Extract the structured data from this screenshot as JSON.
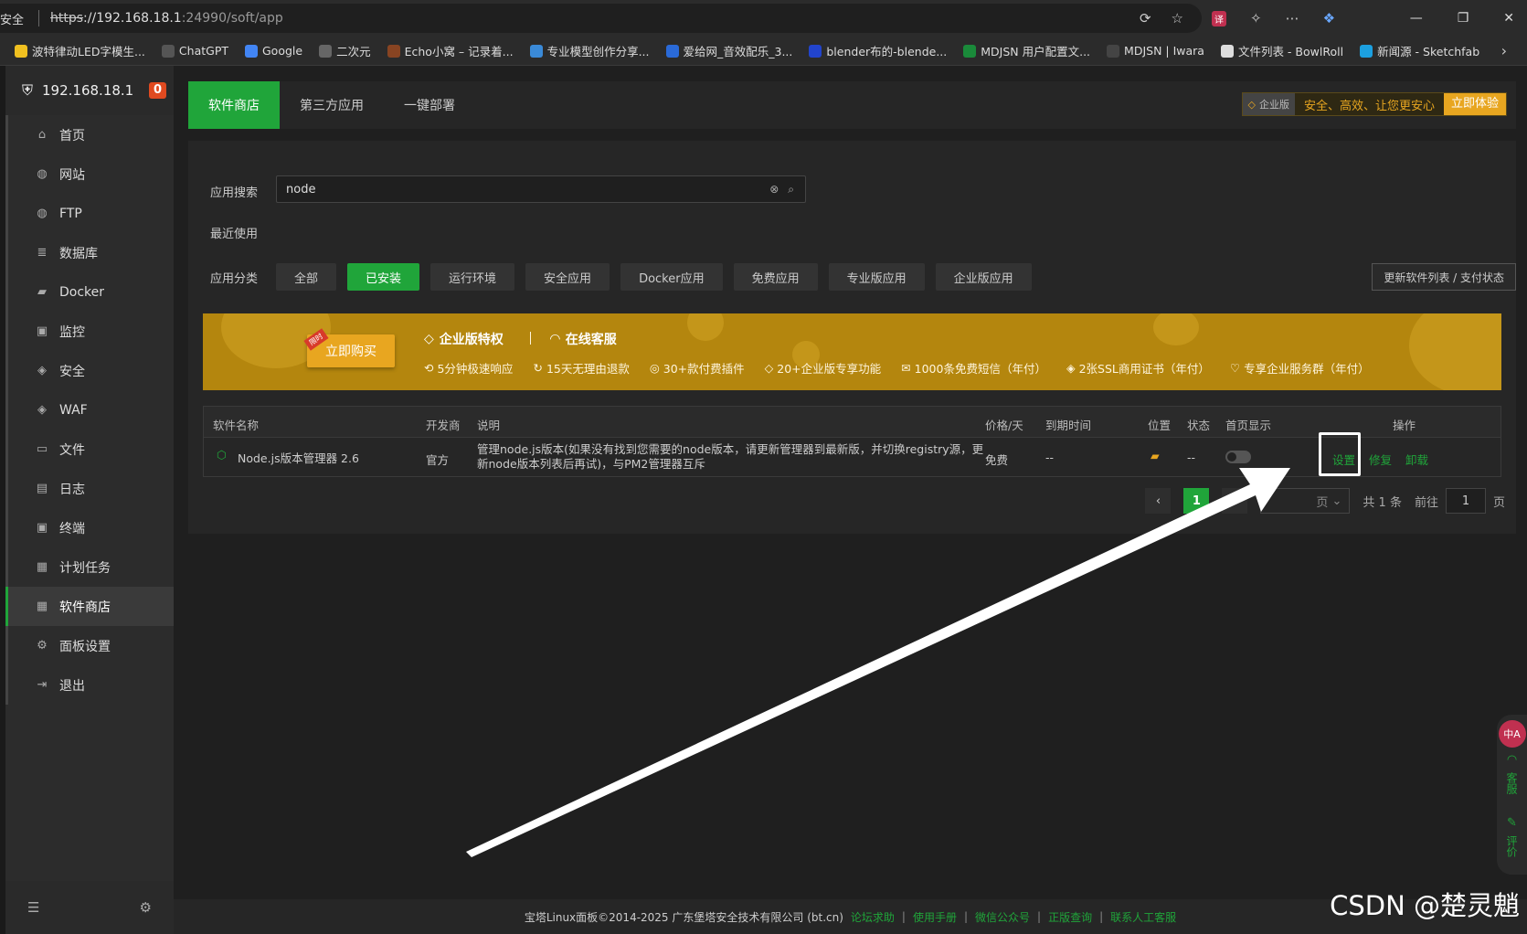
{
  "browser": {
    "security_label": "安全",
    "url_scheme": "https",
    "url_host": "://192.168.18.1",
    "url_path": ":24990/soft/app",
    "bookmarks": [
      {
        "label": "波特律动LED字模生...",
        "color": "#f0c020"
      },
      {
        "label": "ChatGPT",
        "color": "#555"
      },
      {
        "label": "Google",
        "color": "#4285f4"
      },
      {
        "label": "二次元",
        "color": "#666"
      },
      {
        "label": "Echo小窝 – 记录着...",
        "color": "#884422"
      },
      {
        "label": "专业模型创作分享...",
        "color": "#3a8ad8"
      },
      {
        "label": "爱给网_音效配乐_3...",
        "color": "#2a6ad8"
      },
      {
        "label": "blender布的-blende...",
        "color": "#2244cc"
      },
      {
        "label": "MDJSN 用户配置文...",
        "color": "#1a8a3a"
      },
      {
        "label": "MDJSN | Iwara",
        "color": "#444"
      },
      {
        "label": "文件列表 - BowlRoll",
        "color": "#ddd"
      },
      {
        "label": "新闻源 - Sketchfab",
        "color": "#1ca0e0"
      }
    ]
  },
  "sidebar": {
    "host": "192.168.18.1",
    "badge": "0",
    "items": [
      {
        "label": "首页",
        "icon": "⌂"
      },
      {
        "label": "网站",
        "icon": "◍"
      },
      {
        "label": "FTP",
        "icon": "◍"
      },
      {
        "label": "数据库",
        "icon": "≣"
      },
      {
        "label": "Docker",
        "icon": "▰"
      },
      {
        "label": "监控",
        "icon": "▣"
      },
      {
        "label": "安全",
        "icon": "◈"
      },
      {
        "label": "WAF",
        "icon": "◈"
      },
      {
        "label": "文件",
        "icon": "▭"
      },
      {
        "label": "日志",
        "icon": "▤"
      },
      {
        "label": "终端",
        "icon": "▣"
      },
      {
        "label": "计划任务",
        "icon": "▦"
      },
      {
        "label": "软件商店",
        "icon": "▦"
      },
      {
        "label": "面板设置",
        "icon": "⚙"
      },
      {
        "label": "退出",
        "icon": "⇥"
      }
    ]
  },
  "tabs": [
    "软件商店",
    "第三方应用",
    "一键部署"
  ],
  "promo_top": {
    "ent": "企业版",
    "slogan": "安全、高效、让您更安心",
    "try": "立即体验"
  },
  "search": {
    "label": "应用搜索",
    "value": "node"
  },
  "recent_label": "最近使用",
  "category": {
    "label": "应用分类",
    "items": [
      "全部",
      "已安装",
      "运行环境",
      "安全应用",
      "Docker应用",
      "免费应用",
      "专业版应用",
      "企业版应用"
    ],
    "update_btn": "更新软件列表 / 支付状态"
  },
  "banner": {
    "buy": "立即购买",
    "buy_tag": "限时",
    "title1": "企业版特权",
    "title2": "在线客服",
    "features": [
      "5分钟极速响应",
      "15天无理由退款",
      "30+款付费插件",
      "20+企业版专享功能",
      "1000条免费短信（年付）",
      "2张SSL商用证书（年付）",
      "专享企业服务群（年付）"
    ]
  },
  "table": {
    "headers": [
      "软件名称",
      "开发商",
      "说明",
      "价格/天",
      "到期时间",
      "位置",
      "状态",
      "首页显示",
      "操作"
    ],
    "row": {
      "name": "Node.js版本管理器 2.6",
      "vendor": "官方",
      "desc": "管理node.js版本(如果没有找到您需要的node版本，请更新管理器到最新版，并切换registry源，更新node版本列表后再试)，与PM2管理器互斥",
      "price": "免费",
      "expire": "--",
      "status": "--",
      "ops": [
        "设置",
        "修复",
        "卸载"
      ]
    }
  },
  "pager": {
    "current": "1",
    "per_page": "页",
    "total": "共 1 条",
    "goto": "前往",
    "goto_value": "1",
    "page_unit": "页"
  },
  "footer": {
    "copyright": "宝塔Linux面板©2014-2025 广东堡塔安全技术有限公司 (bt.cn)",
    "links": [
      "论坛求助",
      "使用手册",
      "微信公众号",
      "正版查询",
      "联系人工客服"
    ]
  },
  "float": {
    "service": "客服",
    "review": "评价",
    "lang": "中A"
  },
  "watermark": "CSDN @楚灵魈"
}
